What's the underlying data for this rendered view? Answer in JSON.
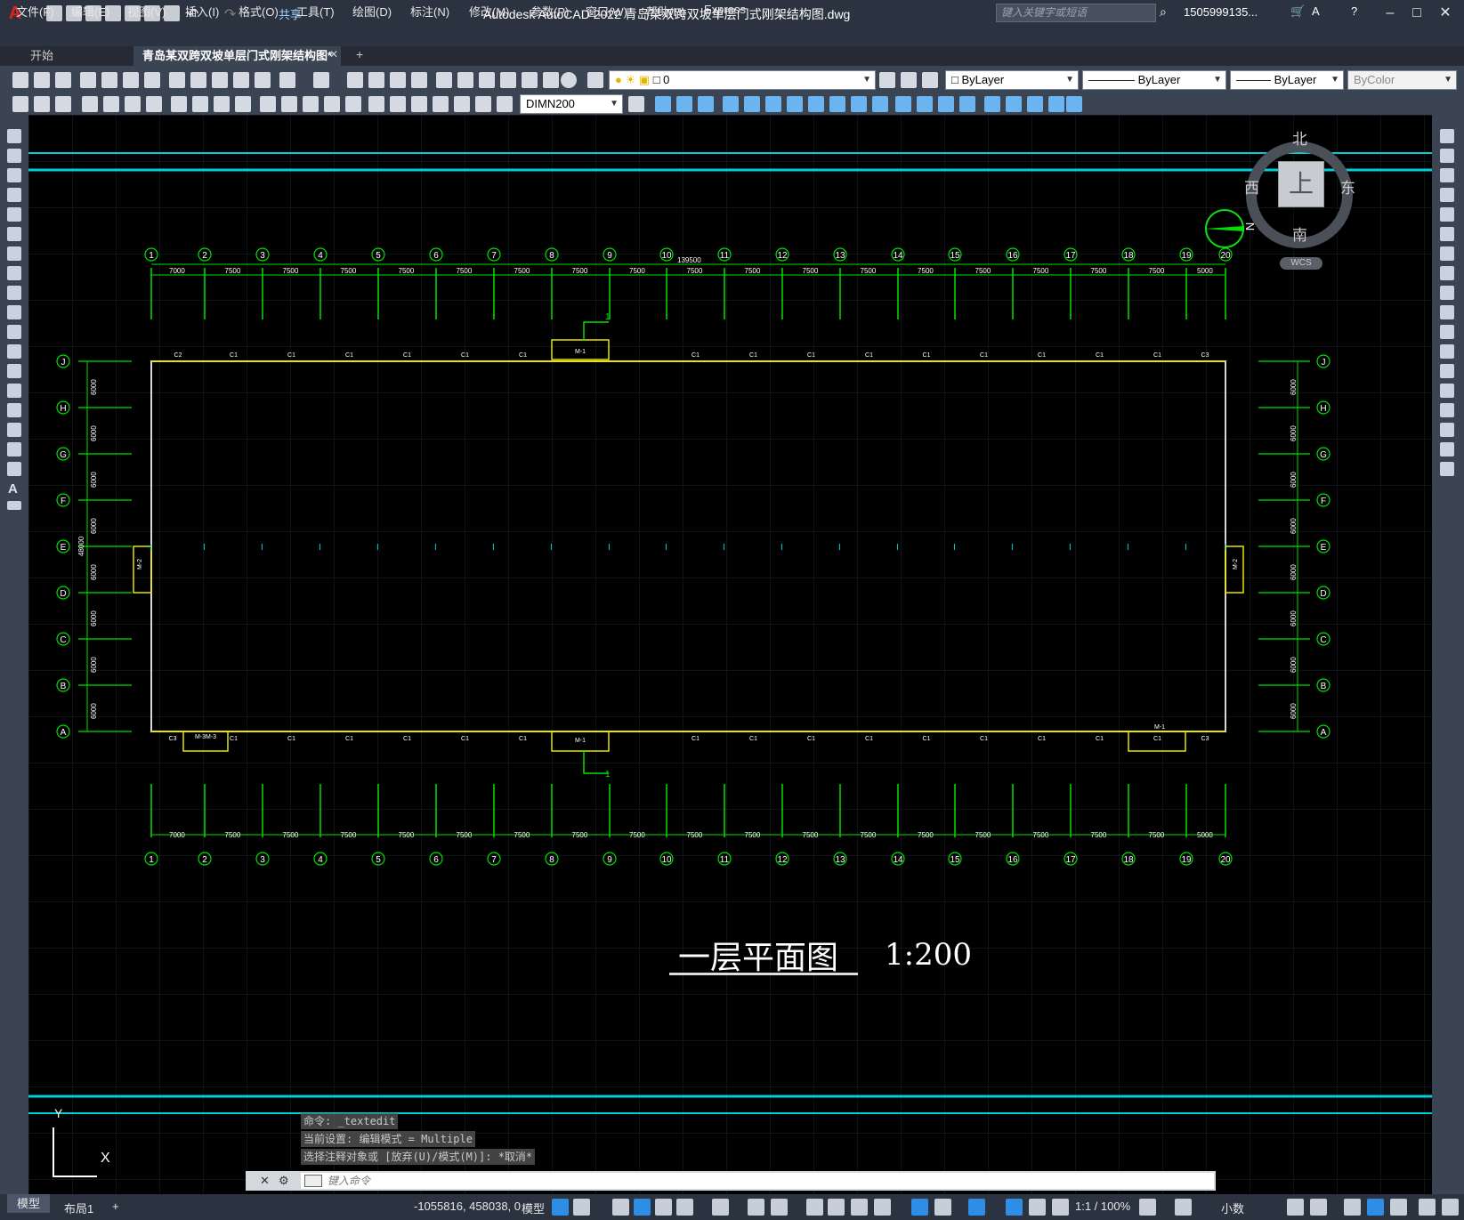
{
  "app": {
    "logo": "A",
    "share": "共享",
    "window_title": "Autodesk AutoCAD 2022    青岛某双跨双坡单层门式刚架结构图.dwg",
    "search_placeholder": "键入关键字或短语",
    "user": "1505999135..."
  },
  "menu": [
    "文件(F)",
    "编辑(E)",
    "视图(V)",
    "插入(I)",
    "格式(O)",
    "工具(T)",
    "绘图(D)",
    "标注(N)",
    "修改(M)",
    "参数(P)",
    "窗口(W)",
    "帮助(H)",
    "Express"
  ],
  "tabs": [
    "开始",
    "青岛某双跨双坡单层门式刚架结构图*"
  ],
  "toolbar": {
    "layer_value": "0",
    "color": "ByLayer",
    "linetype": "ByLayer",
    "lineweight": "ByLayer",
    "plotstyle": "ByColor",
    "dimstyle": "DIMN200"
  },
  "viewcube": {
    "north": "北",
    "south": "南",
    "east": "东",
    "west": "西",
    "top": "上",
    "wcs": "WCS"
  },
  "drawing": {
    "title": "一层平面图",
    "scale": "1:200",
    "axes_numbers": [
      "1",
      "2",
      "3",
      "4",
      "5",
      "6",
      "7",
      "8",
      "9",
      "10",
      "11",
      "12",
      "13",
      "14",
      "15",
      "16",
      "17",
      "18",
      "19",
      "20"
    ],
    "axes_letters": [
      "J",
      "H",
      "G",
      "F",
      "E",
      "D",
      "C",
      "B",
      "A"
    ],
    "top_span_dims": [
      "7000",
      "7500",
      "7500",
      "7500",
      "7500",
      "7500",
      "7500",
      "7500",
      "7500",
      "7500",
      "7500",
      "7500",
      "7500",
      "7500",
      "7500",
      "7500",
      "7500",
      "7500",
      "5000"
    ],
    "total_length": "139500",
    "side_dims": [
      "6000",
      "6000",
      "6000",
      "6000",
      "6000",
      "6000",
      "6000",
      "6000"
    ],
    "total_width": "48000",
    "windows": {
      "c1": "C1",
      "c2": "C2",
      "c3": "C3"
    },
    "doors": {
      "m1": "M-1",
      "m2": "M-2",
      "m3": "M-3M-3"
    },
    "section": "1",
    "north": "N"
  },
  "command": {
    "lines": [
      "命令: _textedit",
      "当前设置: 编辑模式 = Multiple",
      "选择注释对象或 [放弃(U)/模式(M)]: *取消*"
    ],
    "placeholder": "键入命令"
  },
  "ucs": {
    "x": "X",
    "y": "Y"
  },
  "status": {
    "model_tab": "模型",
    "layout_tab": "布局1",
    "add": "+",
    "coords": "-1055816, 458038, 0",
    "model": "模型",
    "scale": "1:1 / 100%",
    "units": "小数"
  },
  "colors": {
    "canvas": "#000000",
    "grid": "#1c2431",
    "axis": "#00e000",
    "wall": "#e6e600",
    "cyan": "#00d8e0",
    "ui": "#3b4453"
  }
}
